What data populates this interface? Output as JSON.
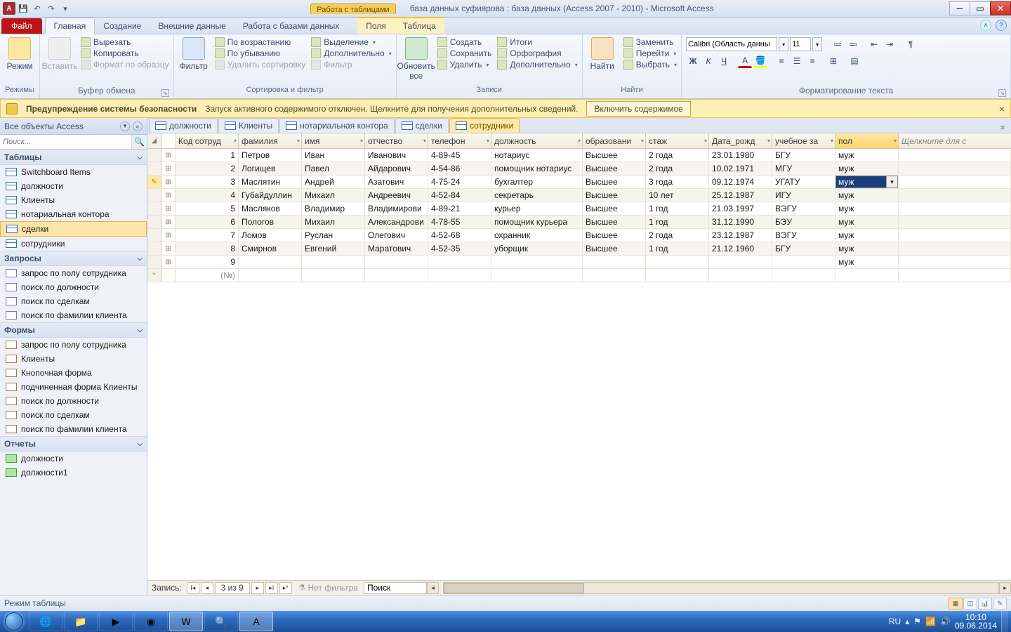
{
  "title": {
    "ctx": "Работа с таблицами",
    "text": "база данных суфиярова : база данных (Access 2007 - 2010)  -  Microsoft Access"
  },
  "ribbon_tabs": {
    "file": "Файл",
    "main": "Главная",
    "create": "Создание",
    "ext": "Внешние данные",
    "dbtools": "Работа с базами данных",
    "fields": "Поля",
    "table": "Таблица"
  },
  "ribbon": {
    "view": "Режим",
    "view_grp": "Режимы",
    "paste": "Вставить",
    "cut": "Вырезать",
    "copy": "Копировать",
    "fmtpaint": "Формат по образцу",
    "clip_grp": "Буфер обмена",
    "filter": "Фильтр",
    "asc": "По возрастанию",
    "desc": "По убыванию",
    "clrsort": "Удалить сортировку",
    "sel": "Выделение",
    "adv": "Дополнительно",
    "tog": "Фильтр",
    "sort_grp": "Сортировка и фильтр",
    "refresh": "Обновить все",
    "new": "Создать",
    "save": "Сохранить",
    "del": "Удалить",
    "totals": "Итоги",
    "spell": "Орфография",
    "more": "Дополнительно",
    "rec_grp": "Записи",
    "find": "Найти",
    "replace": "Заменить",
    "goto": "Перейти",
    "select": "Выбрать",
    "find_grp": "Найти",
    "font": "Calibri (Область данны",
    "size": "11",
    "fmt_grp": "Форматирование текста"
  },
  "sec": {
    "title": "Предупреждение системы безопасности",
    "msg": "Запуск активного содержимого отключен. Щелкните для получения дополнительных сведений.",
    "enable": "Включить содержимое"
  },
  "nav": {
    "title": "Все объекты Access",
    "search_ph": "Поиск...",
    "cats": {
      "tables": "Таблицы",
      "queries": "Запросы",
      "forms": "Формы",
      "reports": "Отчеты"
    },
    "tables": [
      "Switchboard Items",
      "должности",
      "Клиенты",
      "нотариальная контора",
      "сделки",
      "сотрудники"
    ],
    "queries": [
      "запрос по полу сотрудника",
      "поиск по должности",
      "поиск по сделкам",
      "поиск по фамилии клиента"
    ],
    "forms": [
      "запрос по полу сотрудника",
      "Клиенты",
      "Кнопочная форма",
      "подчиненная форма Клиенты",
      "поиск по должности",
      "поиск по сделкам",
      "поиск по фамилии клиента"
    ],
    "reports": [
      "должности",
      "должности1"
    ]
  },
  "objtabs": [
    "должности",
    "Клиенты",
    "нотариальная контора",
    "сделки",
    "сотрудники"
  ],
  "cols": [
    "Код сотруд",
    "фамилия",
    "имя",
    "отчество",
    "телефон",
    "должность",
    "образовани",
    "стаж",
    "Дата_рожд",
    "учебное за",
    "пол"
  ],
  "addcol": "Щелкните для с",
  "rows": [
    {
      "id": "1",
      "fam": "Петров",
      "name": "Иван",
      "otc": "Иванович",
      "tel": "4-89-45",
      "dol": "нотариус",
      "obr": "Высшее",
      "st": "2 года",
      "dr": "23.01.1980",
      "uz": "БГУ",
      "pol": "муж"
    },
    {
      "id": "2",
      "fam": "Логищев",
      "name": "Павел",
      "otc": "Айдарович",
      "tel": "4-54-86",
      "dol": "помощник нотариус",
      "obr": "Высшее",
      "st": "2 года",
      "dr": "10.02.1971",
      "uz": "МГУ",
      "pol": "муж"
    },
    {
      "id": "3",
      "fam": "Маслятин",
      "name": "Андрей",
      "otc": "Азатович",
      "tel": "4-75-24",
      "dol": "бухгалтер",
      "obr": "Высшее",
      "st": "3 года",
      "dr": "09.12.1974",
      "uz": "УГАТУ",
      "pol": "муж"
    },
    {
      "id": "4",
      "fam": "Губайдуллин",
      "name": "Михаил",
      "otc": "Андреевич",
      "tel": "4-52-84",
      "dol": "секретарь",
      "obr": "Высшее",
      "st": "10 лет",
      "dr": "25.12.1987",
      "uz": "ИГУ",
      "pol": "муж"
    },
    {
      "id": "5",
      "fam": "Масляков",
      "name": "Владимир",
      "otc": "Владимирови",
      "tel": "4-89-21",
      "dol": "курьер",
      "obr": "Высшее",
      "st": "1 год",
      "dr": "21.03.1997",
      "uz": "ВЭГУ",
      "pol": "муж"
    },
    {
      "id": "6",
      "fam": "Пологов",
      "name": "Михаил",
      "otc": "Александрови",
      "tel": "4-78-55",
      "dol": "помощник курьера",
      "obr": "Высшее",
      "st": "1 год",
      "dr": "31.12.1990",
      "uz": "БЭУ",
      "pol": "муж"
    },
    {
      "id": "7",
      "fam": "Ломов",
      "name": "Руслан",
      "otc": "Олегович",
      "tel": "4-52-68",
      "dol": "охранник",
      "obr": "Высшее",
      "st": "2 года",
      "dr": "23.12.1987",
      "uz": "ВЭГУ",
      "pol": "муж"
    },
    {
      "id": "8",
      "fam": "Смирнов",
      "name": "Евгений",
      "otc": "Маратович",
      "tel": "4-52-35",
      "dol": "уборщик",
      "obr": "Высшее",
      "st": "1 год",
      "dr": "21.12.1960",
      "uz": "БГУ",
      "pol": "муж"
    },
    {
      "id": "9",
      "fam": "",
      "name": "",
      "otc": "",
      "tel": "",
      "dol": "",
      "obr": "",
      "st": "",
      "dr": "",
      "uz": "",
      "pol": "муж"
    }
  ],
  "newrow_id": "(№)",
  "recnav": {
    "label": "Запись:",
    "pos": "3 из 9",
    "nofilter": "Нет фильтра",
    "search": "Поиск"
  },
  "status": {
    "mode": "Режим таблицы"
  },
  "tray": {
    "lang": "RU",
    "time": "10:10",
    "date": "09.06.2014"
  }
}
